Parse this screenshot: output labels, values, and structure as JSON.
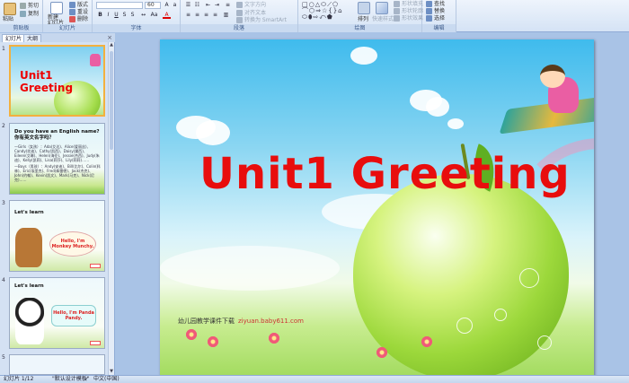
{
  "ribbon": {
    "groups": [
      {
        "name": "clipboard",
        "label": "剪贴板"
      },
      {
        "name": "slides",
        "label": "幻灯片"
      },
      {
        "name": "font",
        "label": "字体"
      },
      {
        "name": "paragraph",
        "label": "段落"
      },
      {
        "name": "drawing",
        "label": "绘图"
      },
      {
        "name": "editing",
        "label": "编辑"
      }
    ],
    "clipboard": {
      "paste": "粘贴",
      "cut": "剪切",
      "copy": "复制",
      "format_painter": "格式刷"
    },
    "slides": {
      "new_slide": "新建\n幻灯片",
      "layout": "版式",
      "reset": "重设",
      "delete": "删除"
    },
    "font": {
      "font_name": "",
      "font_size": "60"
    },
    "paragraph": {
      "text_direction": "文字方向",
      "align_text": "对齐文本",
      "smartart": "转换为 SmartArt"
    },
    "drawing": {
      "arrange": "排列",
      "quick_styles": "快速样式",
      "shape_fill": "形状填充",
      "shape_outline": "形状轮廓",
      "shape_effects": "形状效果"
    },
    "editing": {
      "find": "查找",
      "replace": "替换",
      "select": "选择"
    }
  },
  "left_pane": {
    "tabs": [
      {
        "label": "幻灯片"
      },
      {
        "label": "大纲"
      }
    ],
    "thumbnails": [
      {
        "num": "1",
        "title": "Unit1 Greeting"
      },
      {
        "num": "2",
        "heading1": "Do you have an English name?",
        "heading2": "你有英文名字吗？",
        "line1": "—Girls（女孩）：Ada(艾达)、Alice(爱丽丝)、Candy(坎迪)、Cathy(凯西)、Daisy(黛西)、Eileen(艾琳)、Helen(海伦)、Jessie(杰西)、Judy(朱迪)、Kelly(凯莉)、Lisa(莉莎)、Lily(莉莉)……",
        "line2": "—Boys（男孩）：Andy(安迪)、Bill(比尔)、Colin(科林)、Eric(埃里克)、Fred(弗雷德)、Jack(杰克)、John(约翰)、Kevin(凯文)、Mark(马克)、Nick(尼克)……"
      },
      {
        "num": "3",
        "heading": "Let's learn",
        "bubble": "Hello, I'm Monkey Munchy."
      },
      {
        "num": "4",
        "heading": "Let's learn",
        "bubble": "Hello, I'm Panda Pandy."
      },
      {
        "num": "5"
      }
    ]
  },
  "slide": {
    "title": "Unit1 Greeting",
    "watermark_text": "幼儿园教学课件下载",
    "watermark_url": "ziyuan.baby611.com"
  },
  "status": {
    "slide_counter": "幻灯片 1/12",
    "theme": "\"默认设计模板\"",
    "language": "中文(中国)"
  }
}
